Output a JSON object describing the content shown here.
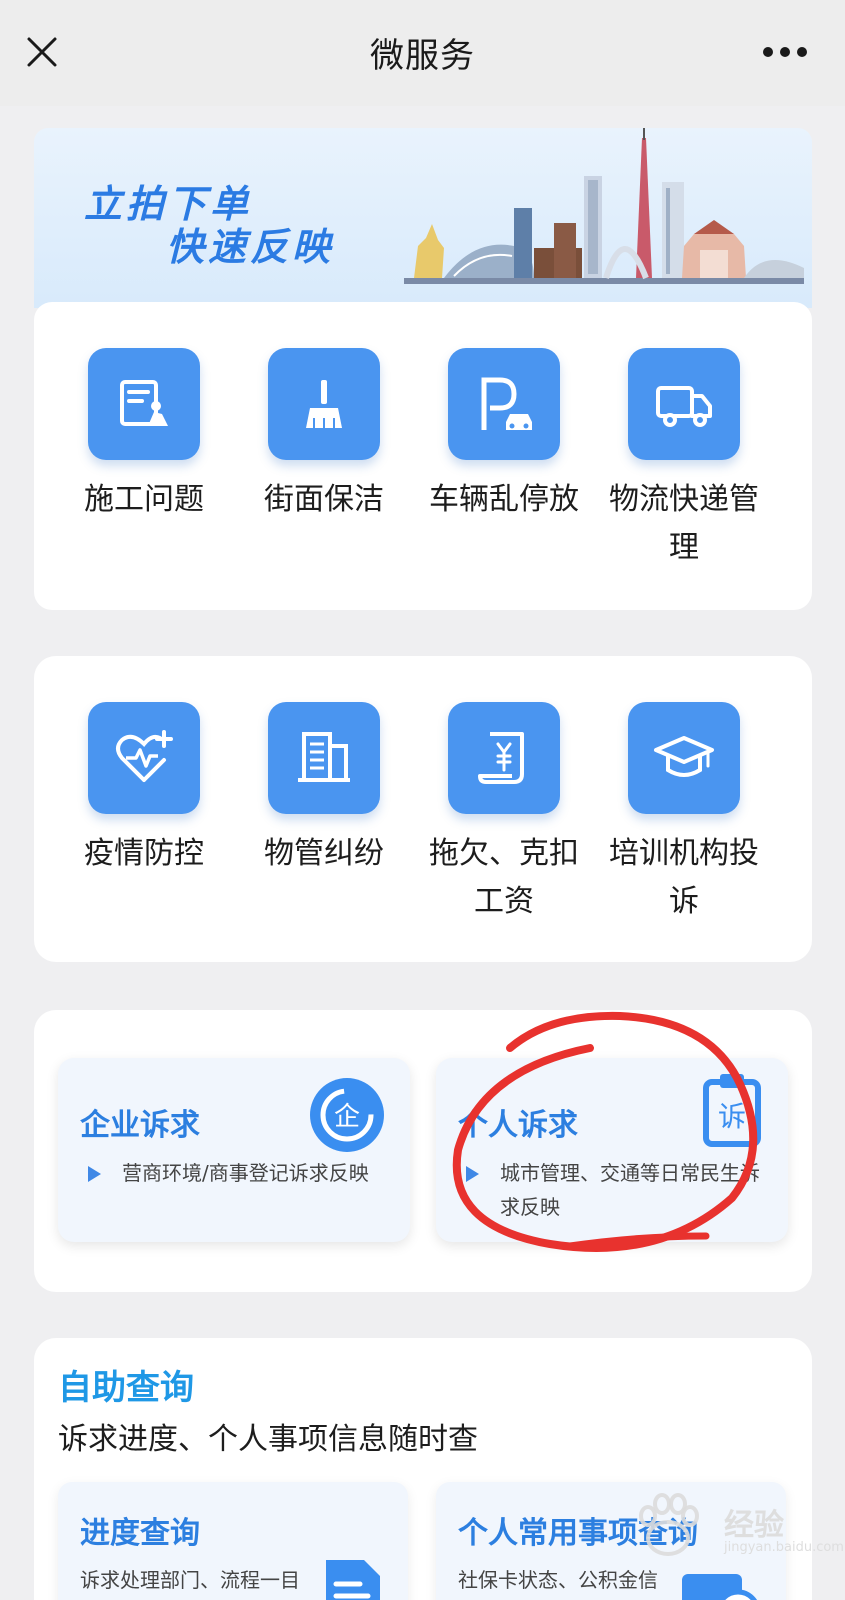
{
  "header": {
    "title": "微服务",
    "close_icon": "close-icon",
    "more_icon": "more-icon"
  },
  "banner": {
    "line1": "立拍下单",
    "line2": "快速反映"
  },
  "services_row1": [
    {
      "label": "施工问题",
      "icon": "construction-icon"
    },
    {
      "label": "街面保洁",
      "icon": "broom-icon"
    },
    {
      "label": "车辆乱停放",
      "icon": "parking-icon"
    },
    {
      "label": "物流快递管理",
      "icon": "truck-icon"
    }
  ],
  "services_row2": [
    {
      "label": "疫情防控",
      "icon": "heart-plus-icon"
    },
    {
      "label": "物管纠纷",
      "icon": "building-icon"
    },
    {
      "label": "拖欠、克扣工资",
      "icon": "salary-scroll-icon"
    },
    {
      "label": "培训机构投诉",
      "icon": "graduation-cap-icon"
    }
  ],
  "appeals": {
    "enterprise": {
      "title": "企业诉求",
      "desc": "营商环境/商事登记诉求反映",
      "icon_text": "企"
    },
    "personal": {
      "title": "个人诉求",
      "desc": "城市管理、交通等日常民生诉求反映",
      "icon_text": "诉"
    }
  },
  "self_service": {
    "title": "自助查询",
    "subtitle": "诉求进度、个人事项信息随时查",
    "cards": [
      {
        "title": "进度查询",
        "desc": "诉求处理部门、流程一目"
      },
      {
        "title": "个人常用事项查询",
        "desc": "社保卡状态、公积金信"
      }
    ]
  },
  "watermark": {
    "text": "经验",
    "url": "jingyan.baidu.com"
  },
  "colors": {
    "accent": "#4a95f0",
    "title_blue": "#2c7fe0",
    "annotation_red": "#e8322e"
  }
}
